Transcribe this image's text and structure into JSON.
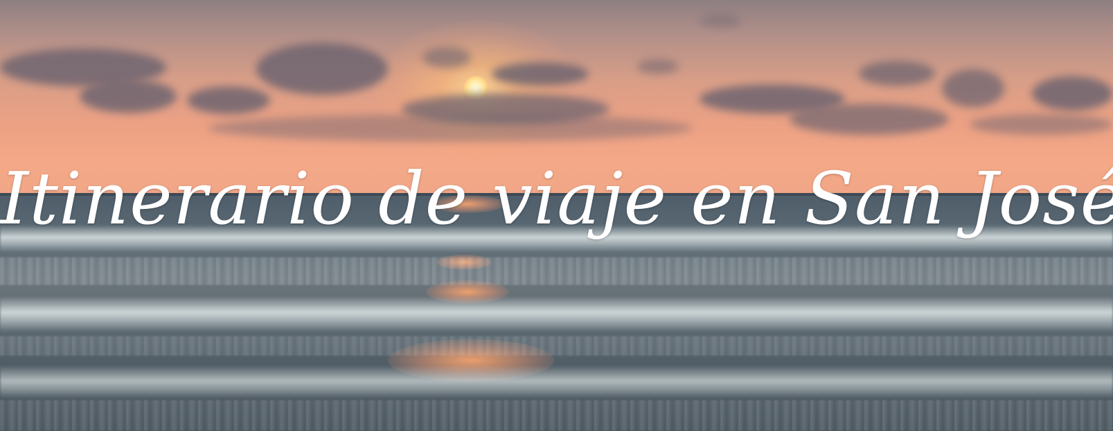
{
  "banner": {
    "title": "Itinerario de viaje en San José"
  },
  "colors": {
    "sky_top": "#8e7f82",
    "sky_horizon": "#f0a687",
    "sun": "#fff3c0",
    "sea": "#5b6a74",
    "foam": "#e1e8e8",
    "title_text": "#ffffff"
  }
}
